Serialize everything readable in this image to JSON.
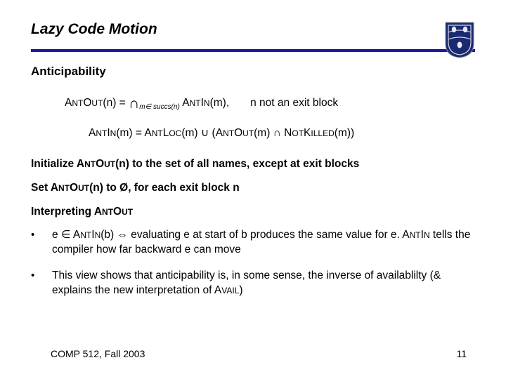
{
  "title": "Lazy Code Motion",
  "section": "Anticipability",
  "eq1": {
    "lhs_pre": "A",
    "lhs_sc1": "NT",
    "lhs_mid1": "O",
    "lhs_sc2": "UT",
    "lhs_arg": "(n) = ",
    "sub": "m∈ succs(n)",
    "rhs_pre": " A",
    "rhs_sc1": "NT",
    "rhs_mid1": "I",
    "rhs_sc2": "N",
    "rhs_arg": "(m),",
    "cond": "n not an exit block"
  },
  "eq2": {
    "lhs": "ANTIN(m) = ANTLOC(m) ∪ (ANTOUT(m) ∩ NOTKILLED(m))",
    "p1a": "A",
    "p1b": "NT",
    "p1c": "I",
    "p1d": "N",
    "p1e": "(m) = A",
    "p1f": "NT",
    "p1g": "L",
    "p1h": "OC",
    "p1i": "(m) ",
    "cup": "∪",
    "p2a": " (A",
    "p2b": "NT",
    "p2c": "O",
    "p2d": "UT",
    "p2e": "(m) ",
    "cap": "∩",
    "p3a": " N",
    "p3b": "OT",
    "p3c": "K",
    "p3d": "ILLED",
    "p3e": "(m))"
  },
  "init": {
    "a": "Initialize A",
    "b": "NT",
    "c": "O",
    "d": "UT",
    "e": "(n) to the set of all names, except at exit blocks"
  },
  "set": {
    "a": "Set A",
    "b": "NT",
    "c": "O",
    "d": "UT",
    "e": "(n) to Ø, for each exit block n"
  },
  "interp": {
    "a": "Interpreting A",
    "b": "NT",
    "c": "O",
    "d": "UT"
  },
  "bullet1": {
    "a": "e ",
    "el": "∈",
    "b": " A",
    "c": "NT",
    "d": "I",
    "e": "N",
    "f": "(b) ",
    "imp": "⇔",
    "g": " evaluating e at start of b produces the same value for e. A",
    "h": "NT",
    "i": "I",
    "j": "N",
    "k": " tells the compiler how far backward e can move"
  },
  "bullet2": {
    "a": "This view shows that anticipability is, in some sense, the inverse of availablilty (& explains the new interpretation of A",
    "b": "VAIL",
    "c": ")"
  },
  "footer_left": "COMP 512, Fall 2003",
  "footer_right": "11"
}
